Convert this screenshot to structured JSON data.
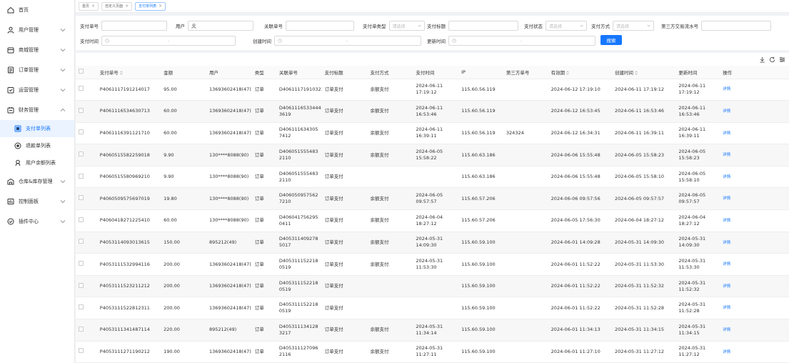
{
  "sidebar": {
    "items": [
      {
        "label": "首页",
        "icon": "home-icon",
        "chevron": false
      },
      {
        "label": "用户管理",
        "icon": "user-icon",
        "chevron": true
      },
      {
        "label": "商城管理",
        "icon": "shop-icon",
        "chevron": true
      },
      {
        "label": "订单管理",
        "icon": "order-icon",
        "chevron": true
      },
      {
        "label": "运营管理",
        "icon": "operations-icon",
        "chevron": true
      },
      {
        "label": "财务管理",
        "icon": "finance-icon",
        "chevron": true,
        "expanded": true
      },
      {
        "label": "支付单列表",
        "icon": "pay-list-icon",
        "sub": true,
        "active": true
      },
      {
        "label": "退款单列表",
        "icon": "refund-icon",
        "sub": true
      },
      {
        "label": "用户余额列表",
        "icon": "balance-icon",
        "sub": true
      },
      {
        "label": "仓库&库存管理",
        "icon": "warehouse-icon",
        "chevron": true
      },
      {
        "label": "控制面板",
        "icon": "dashboard-icon",
        "chevron": true
      },
      {
        "label": "插件中心",
        "icon": "plugin-icon",
        "chevron": true
      }
    ]
  },
  "tabs": [
    {
      "label": "首页",
      "active": false
    },
    {
      "label": "自定义页面",
      "active": false
    },
    {
      "label": "支付单列表",
      "active": true
    }
  ],
  "filters": {
    "pay_no": "支付单号",
    "user": "用户",
    "related_no": "关联单号",
    "pay_type": "支付单类型",
    "pay_type_ph": "请选择",
    "pay_title": "支付标题",
    "pay_status": "支付状态",
    "pay_status_ph": "请选择",
    "pay_method": "支付方式",
    "pay_method_ph": "请选择",
    "third_flow": "第三方交易流水号",
    "pay_time": "支付时间",
    "create_time": "创建时间",
    "update_time": "更新时间",
    "range_sep": "-",
    "search": "搜索"
  },
  "table": {
    "headers": [
      "支付单号",
      "金额",
      "用户",
      "类型",
      "关联单号",
      "支付标题",
      "支付方式",
      "支付时间",
      "IP",
      "第三方单号",
      "有效期",
      "创建时间",
      "更新时间",
      "操作"
    ],
    "action_label": "详情",
    "rows": [
      [
        "P4061117191214017",
        "95.00",
        "13693602418(47)",
        "订单",
        "D406111719103216",
        "订单支付",
        "余额支付",
        "2024-06-11 17:19:12",
        "115.60.56.119",
        "",
        "2024-06-12 17:19:10",
        "2024-06-11 17:19:12",
        "2024-06-11 17:19:12"
      ],
      [
        "P4061116534630713",
        "60.00",
        "13693602418(47)",
        "订单",
        "D4061116533444 3619",
        "订单支付",
        "余额支付",
        "2024-06-11 16:53:46",
        "115.60.56.119",
        "",
        "2024-06-12 16:53:45",
        "2024-06-11 16:53:46",
        "2024-06-11 16:53:46"
      ],
      [
        "P4061116391121710",
        "60.00",
        "13693602418(47)",
        "订单",
        "D406111634305 7412",
        "订单支付",
        "余额支付",
        "2024-06-11 16:39:11",
        "115.60.56.119",
        "324324",
        "2024-06-12 16:34:31",
        "2024-06-11 16:39:11",
        "2024-06-11 16:39:11"
      ],
      [
        "P4060515582259018",
        "9.90",
        "130****8088(90)",
        "订单",
        "D406051555483 2110",
        "订单支付",
        "余额支付",
        "2024-06-05 15:58:22",
        "115.60.63.186",
        "",
        "2024-06-06 15:55:48",
        "2024-06-05 15:58:23",
        "2024-06-05 15:58:23"
      ],
      [
        "P4060515580969210",
        "9.90",
        "130****8088(90)",
        "订单",
        "D406051555483 2110",
        "订单支付",
        "",
        "",
        "115.60.63.186",
        "",
        "2024-06-06 15:55:48",
        "2024-06-05 15:58:10",
        "2024-06-05 15:58:10"
      ],
      [
        "P4060509575697019",
        "19.80",
        "130****8088(90)",
        "订单",
        "D406050957562 7210",
        "订单支付",
        "余额支付",
        "2024-06-05 09:57:57",
        "115.60.57.206",
        "",
        "2024-06-06 09:57:56",
        "2024-06-05 09:57:57",
        "2024-06-05 09:57:57"
      ],
      [
        "P4060418271225410",
        "60.00",
        "130****8088(90)",
        "订单",
        "D406041756295 0411",
        "订单支付",
        "余额支付",
        "2024-06-04 18:27:12",
        "115.60.57.206",
        "",
        "2024-06-05 17:56:30",
        "2024-06-04 18:27:12",
        "2024-06-04 18:27:12"
      ],
      [
        "P4053114093013615",
        "150.00",
        "895212(49)",
        "订单",
        "D405311409278 5017",
        "订单支付",
        "余额支付",
        "2024-05-31 14:09:30",
        "115.60.59.100",
        "",
        "2024-06-01 14:09:28",
        "2024-05-31 14:09:30",
        "2024-05-31 14:09:30"
      ],
      [
        "P4053111532994116",
        "200.00",
        "13693602418(47)",
        "订单",
        "D405311152218 0519",
        "订单支付",
        "余额支付",
        "2024-05-31 11:53:30",
        "115.60.59.100",
        "",
        "2024-06-01 11:52:22",
        "2024-05-31 11:53:30",
        "2024-05-31 11:53:30"
      ],
      [
        "P4053111523211212",
        "200.00",
        "13693602418(47)",
        "订单",
        "D405311152218 0519",
        "订单支付",
        "",
        "",
        "115.60.59.100",
        "",
        "2024-06-01 11:52:22",
        "2024-05-31 11:52:32",
        "2024-05-31 11:52:32"
      ],
      [
        "P4053111522812311",
        "200.00",
        "13693602418(47)",
        "订单",
        "D405311152218 0519",
        "订单支付",
        "",
        "",
        "115.60.59.100",
        "",
        "2024-06-01 11:52:22",
        "2024-05-31 11:52:28",
        "2024-05-31 11:52:28"
      ],
      [
        "P4053111341487114",
        "220.00",
        "895212(49)",
        "订单",
        "D405311134128 3217",
        "订单支付",
        "余额支付",
        "2024-05-31 11:34:14",
        "115.60.59.100",
        "",
        "2024-06-01 11:34:13",
        "2024-05-31 11:34:15",
        "2024-05-31 11:34:15"
      ],
      [
        "P4053111271190212",
        "190.00",
        "13693602418(47)",
        "订单",
        "D405311127096 2116",
        "订单支付",
        "余额支付",
        "2024-05-31 11:27:11",
        "115.60.59.100",
        "",
        "2024-06-01 11:27:10",
        "2024-05-31 11:27:12",
        "2024-05-31 11:27:12"
      ]
    ]
  },
  "colors": {
    "accent": "#1677ff",
    "active_bg": "#eaf3ff"
  }
}
